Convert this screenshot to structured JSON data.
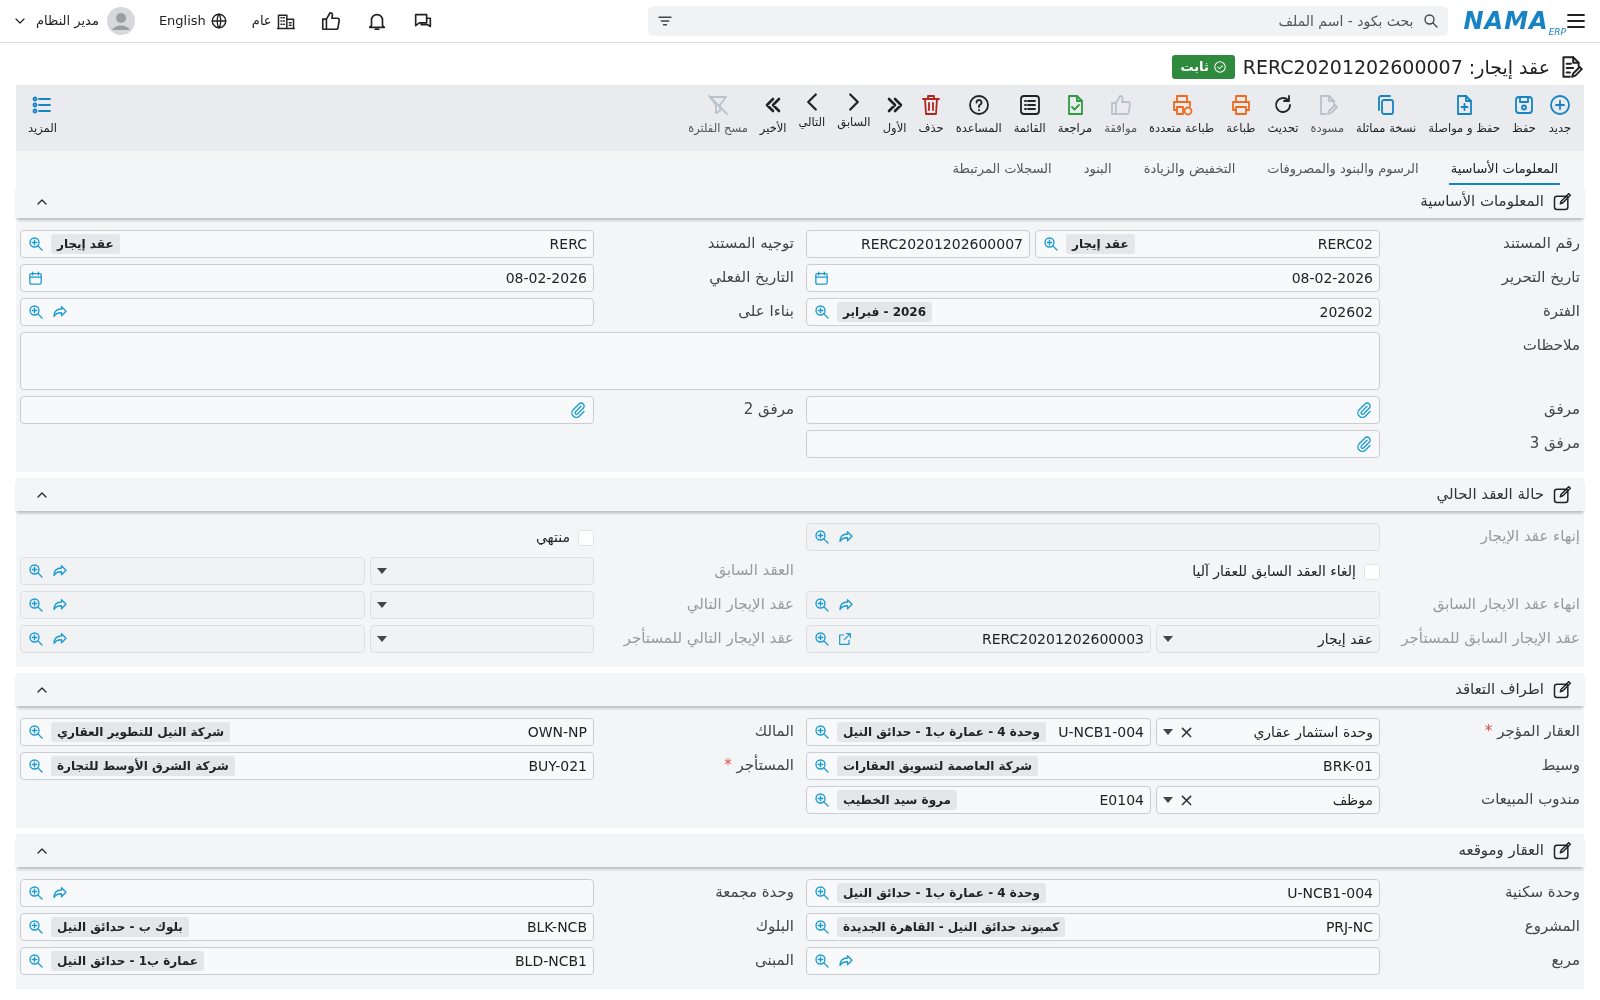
{
  "topbar": {
    "logo": {
      "main": "NAMA",
      "sub": "ERP"
    },
    "search": {
      "placeholder": "بحث بكود - اسم الملف"
    },
    "branch": "عام",
    "language": "English",
    "user": "مدير النظام"
  },
  "title": {
    "text": "عقد إيجار: RERC20201202600007",
    "status": "ثابت"
  },
  "toolbar": [
    {
      "label": "جديد",
      "kind": "new",
      "color": "#1683c4",
      "disabled": false
    },
    {
      "label": "حفظ",
      "kind": "save",
      "color": "#1683c4",
      "disabled": false
    },
    {
      "label": "حفظ و مواصلة",
      "kind": "save-continue",
      "color": "#1683c4",
      "disabled": false
    },
    {
      "label": "نسخة مماثلة",
      "kind": "duplicate",
      "color": "#1683c4",
      "disabled": false
    },
    {
      "label": "مسودة",
      "kind": "draft",
      "color": "#b9c3cc",
      "disabled": true
    },
    {
      "label": "تحديث",
      "kind": "refresh",
      "color": "#222222",
      "disabled": false
    },
    {
      "label": "طباعة",
      "kind": "print",
      "color": "#f06a1d",
      "disabled": false
    },
    {
      "label": "طباعة متعددة",
      "kind": "multi-print",
      "color": "#f06a1d",
      "disabled": false
    },
    {
      "label": "موافقة",
      "kind": "approve",
      "color": "#b9c3cc",
      "disabled": true
    },
    {
      "label": "مراجعة",
      "kind": "review",
      "color": "#2e9a3e",
      "disabled": false
    },
    {
      "label": "القائمة",
      "kind": "list",
      "color": "#222222",
      "disabled": false
    },
    {
      "label": "المساعدة",
      "kind": "help",
      "color": "#222222",
      "disabled": false
    },
    {
      "label": "حذف",
      "kind": "delete",
      "color": "#b3261e",
      "disabled": false
    },
    {
      "label": "الأول",
      "kind": "first",
      "color": "#222222",
      "disabled": false
    },
    {
      "label": "السابق",
      "kind": "previous",
      "color": "#222222",
      "disabled": false
    },
    {
      "label": "التالي",
      "kind": "next",
      "color": "#222222",
      "disabled": false
    },
    {
      "label": "الأخير",
      "kind": "last",
      "color": "#222222",
      "disabled": false
    },
    {
      "label": "مسح الفلترة",
      "kind": "clear-filter",
      "color": "#b9c3cc",
      "disabled": true
    }
  ],
  "more": {
    "label": "المزيد"
  },
  "tabs": [
    {
      "label": "المعلومات الأساسية",
      "selected": true
    },
    {
      "label": "الرسوم والبنود والمصروفات",
      "selected": false
    },
    {
      "label": "التخفيض والزيادة",
      "selected": false
    },
    {
      "label": "البنود",
      "selected": false
    },
    {
      "label": "السجلات المرتبطة",
      "selected": false
    }
  ],
  "sections": [
    {
      "title": "المعلومات الأساسية",
      "expanded": true,
      "rows": [
        {
          "cells": [
            {
              "label": "رقم المستند",
              "disabled": false,
              "controls": [
                {
                  "kind": "lookup",
                  "value": "RERC02",
                  "tag": "عقد إيجار"
                },
                {
                  "kind": "text",
                  "value": "RERC20201202600007"
                }
              ]
            },
            {
              "label": "توجيه المستند",
              "disabled": false,
              "controls": [
                {
                  "kind": "lookup",
                  "value": "RERC",
                  "tag": "عقد إيجار"
                }
              ]
            }
          ]
        },
        {
          "cells": [
            {
              "label": "تاريخ التحرير",
              "disabled": false,
              "controls": [
                {
                  "kind": "date",
                  "value": "08-02-2026"
                }
              ]
            },
            {
              "label": "التاريخ الفعلي",
              "disabled": false,
              "controls": [
                {
                  "kind": "date",
                  "value": "08-02-2026"
                }
              ]
            }
          ]
        },
        {
          "cells": [
            {
              "label": "الفترة",
              "disabled": false,
              "controls": [
                {
                  "kind": "lookup",
                  "value": "202602",
                  "tag": "2026 - فبراير"
                }
              ]
            },
            {
              "label": "بناءا على",
              "disabled": false,
              "controls": [
                {
                  "kind": "reference"
                }
              ]
            }
          ]
        },
        {
          "cells": [
            {
              "label": "ملاحظات",
              "disabled": false,
              "controls": [
                {
                  "kind": "textarea"
                }
              ]
            }
          ]
        },
        {
          "cells": [
            {
              "label": "مرفق",
              "disabled": false,
              "controls": [
                {
                  "kind": "attach"
                }
              ]
            },
            {
              "label": "مرفق 2",
              "disabled": false,
              "controls": [
                {
                  "kind": "attach"
                }
              ]
            }
          ]
        },
        {
          "cells": [
            {
              "label": "مرفق 3",
              "disabled": false,
              "controls": [
                {
                  "kind": "attach"
                }
              ]
            }
          ]
        }
      ]
    },
    {
      "title": "حالة العقد الحالي",
      "expanded": true,
      "rows": [
        {
          "cells": [
            {
              "label": "إنهاء عقد الإيجار",
              "disabled": true,
              "controls": [
                {
                  "kind": "reference"
                }
              ]
            },
            {
              "controls": [
                {
                  "kind": "checkbox",
                  "label": "منتهي",
                  "checked": false
                }
              ]
            }
          ]
        },
        {
          "cells": [
            {
              "controls": [
                {
                  "kind": "checkbox",
                  "label": "إلغاء العقد السابق للعقار آليا",
                  "checked": false
                }
              ]
            },
            {
              "label": "العقد السابق",
              "disabled": true,
              "controls": [
                {
                  "kind": "select"
                },
                {
                  "kind": "reference"
                }
              ]
            }
          ]
        },
        {
          "cells": [
            {
              "label": "انهاء عقد الايجار السابق",
              "disabled": true,
              "controls": [
                {
                  "kind": "reference"
                }
              ]
            },
            {
              "label": "عقد الإيجار التالي",
              "disabled": true,
              "controls": [
                {
                  "kind": "select"
                },
                {
                  "kind": "reference"
                }
              ]
            }
          ]
        },
        {
          "cells": [
            {
              "label": "عقد الإيجار السابق للمستأجر",
              "disabled": true,
              "controls": [
                {
                  "kind": "select",
                  "value": "عقد إيجار"
                },
                {
                  "kind": "linked",
                  "value": "RERC20201202600003"
                }
              ]
            },
            {
              "label": "عقد الإيجار التالي للمستأجر",
              "disabled": true,
              "controls": [
                {
                  "kind": "select"
                },
                {
                  "kind": "reference"
                }
              ]
            }
          ]
        }
      ]
    },
    {
      "title": "اطراف التعاقد",
      "expanded": true,
      "rows": [
        {
          "cells": [
            {
              "label": "العقار المؤجر",
              "required": "*",
              "disabled": false,
              "controls": [
                {
                  "kind": "select",
                  "value": "وحدة استثمار عقاري",
                  "clear": "×"
                },
                {
                  "kind": "lookup",
                  "value": "U-NCB1-004",
                  "tag": "وحدة 4 - عمارة ب1 - حدائق النيل"
                }
              ]
            },
            {
              "label": "المالك",
              "disabled": false,
              "controls": [
                {
                  "kind": "lookup",
                  "value": "OWN-NP",
                  "tag": "شركة النيل للتطوير العقاري"
                }
              ]
            }
          ]
        },
        {
          "cells": [
            {
              "label": "وسيط",
              "disabled": false,
              "controls": [
                {
                  "kind": "lookup",
                  "value": "BRK-01",
                  "tag": "شركة العاصمة لتسويق العقارات"
                }
              ]
            },
            {
              "label": "المستأجر",
              "required": "*",
              "disabled": false,
              "controls": [
                {
                  "kind": "lookup",
                  "value": "BUY-021",
                  "tag": "شركة الشرق الأوسط للتجارة"
                }
              ]
            }
          ]
        },
        {
          "cells": [
            {
              "label": "مندوب المبيعات",
              "disabled": false,
              "controls": [
                {
                  "kind": "select",
                  "value": "موظف",
                  "clear": "×"
                },
                {
                  "kind": "lookup",
                  "value": "E0104",
                  "tag": "مروة سيد الخطيب"
                }
              ]
            }
          ]
        }
      ]
    },
    {
      "title": "العقار وموقعه",
      "expanded": true,
      "rows": [
        {
          "cells": [
            {
              "label": "وحدة سكنية",
              "disabled": false,
              "controls": [
                {
                  "kind": "lookup",
                  "value": "U-NCB1-004",
                  "tag": "وحدة 4 - عمارة ب1 - حدائق النيل"
                }
              ]
            },
            {
              "label": "وحدة مجمعة",
              "disabled": false,
              "controls": [
                {
                  "kind": "reference"
                }
              ]
            }
          ]
        },
        {
          "cells": [
            {
              "label": "المشروع",
              "disabled": false,
              "controls": [
                {
                  "kind": "lookup",
                  "value": "PRJ-NC",
                  "tag": "كمبوند حدائق النيل - القاهرة الجديدة"
                }
              ]
            },
            {
              "label": "البلوك",
              "disabled": false,
              "controls": [
                {
                  "kind": "lookup",
                  "value": "BLK-NCB",
                  "tag": "بلوك ب - حدائق النيل"
                }
              ]
            }
          ]
        },
        {
          "cells": [
            {
              "label": "مربع",
              "disabled": false,
              "controls": [
                {
                  "kind": "reference"
                }
              ]
            },
            {
              "label": "المبنى",
              "disabled": false,
              "controls": [
                {
                  "kind": "lookup",
                  "value": "BLD-NCB1",
                  "tag": "عمارة ب1 - حدائق النيل"
                }
              ]
            }
          ]
        }
      ]
    }
  ]
}
